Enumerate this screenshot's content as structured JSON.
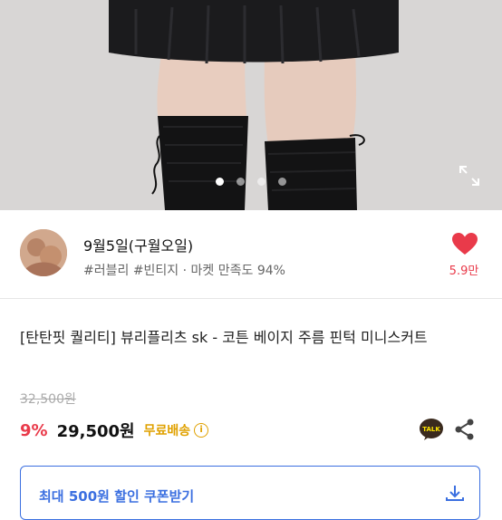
{
  "product_image": {
    "dots": 4,
    "active_dot": 0,
    "expand_icon": "expand-icon"
  },
  "seller": {
    "name": "9월5일(구월오일)",
    "tags": "#러블리 #빈티지 · 마켓 만족도 94%",
    "like_count": "5.9만"
  },
  "product": {
    "title": "[탄탄핏 퀄리티] 뷰리플리츠 sk - 코튼 베이지 주름 핀턱 미니스커트",
    "original_price": "32,500원",
    "discount": "9%",
    "price": "29,500원",
    "shipping": "무료배송",
    "talk_badge": "TALK"
  },
  "coupon": {
    "label": "최대 500원 할인 쿠폰받기"
  },
  "colors": {
    "accent_red": "#e93a4a",
    "coupon_blue": "#3b6fe0",
    "shipping_gold": "#e0a100"
  }
}
